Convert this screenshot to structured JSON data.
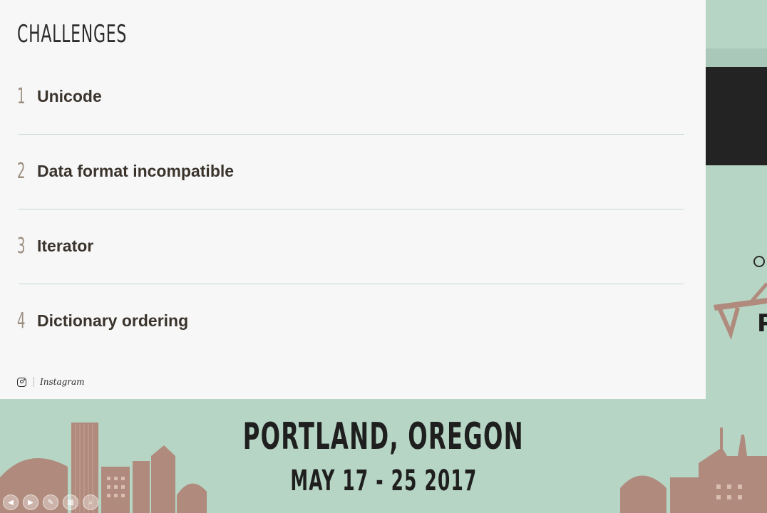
{
  "slide": {
    "title": "CHALLENGES",
    "items": [
      {
        "number": "1",
        "label": "Unicode"
      },
      {
        "number": "2",
        "label": "Data format incompatible"
      },
      {
        "number": "3",
        "label": "Iterator"
      },
      {
        "number": "4",
        "label": "Dictionary ordering"
      }
    ],
    "footer": {
      "icon": "instagram-icon",
      "text": "Instagram"
    }
  },
  "banner": {
    "title": "PORTLAND, OREGON",
    "dates": "MAY 17 - 25 2017"
  },
  "peek": {
    "letter": "P"
  },
  "colors": {
    "background": "#b6d5c4",
    "slide": "#f7f7f7",
    "skyline": "#b08a7c",
    "number": "#9c8f80",
    "text": "#3b342d"
  },
  "controls": [
    "previous-icon",
    "next-icon",
    "edit-icon",
    "grid-icon",
    "zoom-icon"
  ]
}
